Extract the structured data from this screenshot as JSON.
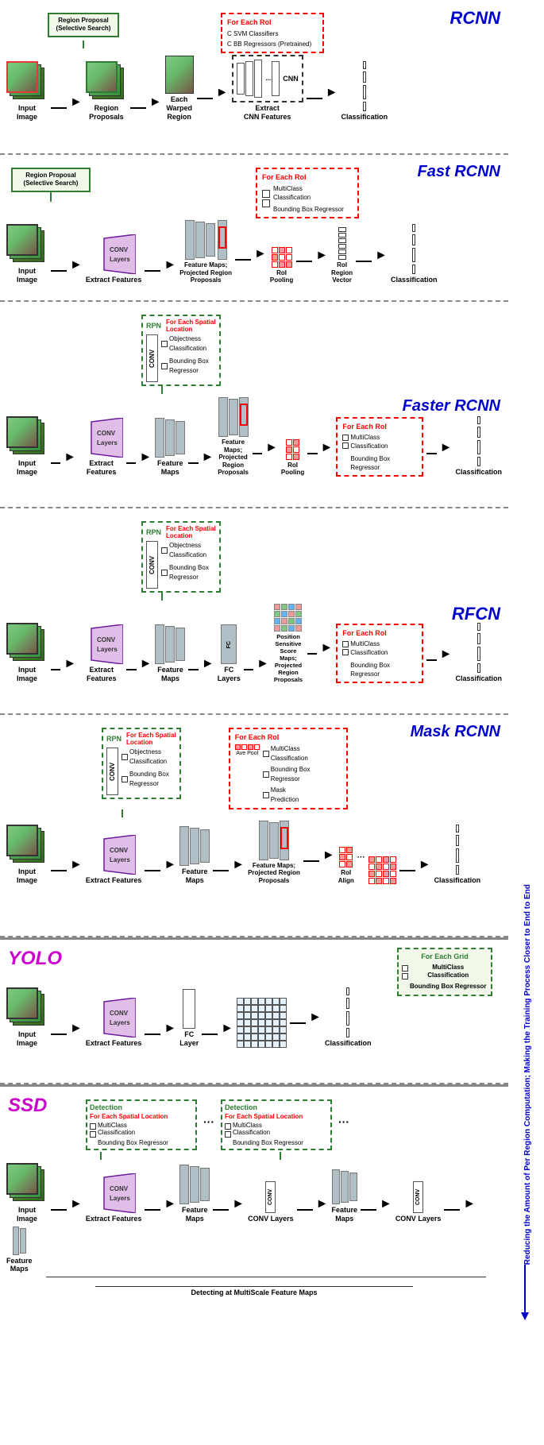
{
  "sections": [
    {
      "id": "rcnn",
      "title": "RCNN",
      "title_color": "#0000cc",
      "region_proposal_label": "Region Proposal\n(Selective Search)",
      "input_image_label": "Input\nImage",
      "region_proposals_label": "Region\nProposals",
      "each_warped_label": "Each\nWarped\nRegion",
      "extract_cnn_label": "Extract\nCNN Features",
      "classification_label": "Classification",
      "for_each_roi": "For Each RoI",
      "svm_label": "C SVM Classifiers",
      "bb_label": "C BB Regressors\n(Pretrained)"
    },
    {
      "id": "fastrcnn",
      "title": "Fast RCNN",
      "title_color": "#0000cc",
      "region_proposal_label": "Region Proposal\n(Selective Search)",
      "input_image_label": "Input\nImage",
      "extract_features_label": "Extract Features",
      "feature_maps_label": "Feature Maps;\nProjected Region\nProposals",
      "roi_region_vector_label": "RoI\nRegion\nVector",
      "classification_label": "Classification",
      "conv_layers_label": "CONV\nLayers",
      "roi_pooling_label": "RoI\nPooling",
      "for_each_roi": "For Each RoI",
      "multiclass_label": "MultiClass\nClassification",
      "bbox_label": "Bounding Box\nRegressor"
    },
    {
      "id": "fasterrcnn",
      "title": "Faster RCNN",
      "title_color": "#0000cc",
      "rpn_label": "RPN",
      "for_each_spatial": "For Each Spatial\nLocation",
      "objectness_label": "Objectness\nClassification",
      "bounding_box_rpn": "Bounding Box\nRegressor",
      "input_image_label": "Input\nImage",
      "extract_features_label": "Extract Features",
      "feature_maps_label": "Feature\nMaps",
      "feature_maps2_label": "Feature Maps;\nProjected Region\nProposals",
      "classification_label": "Classification",
      "conv_layers_label": "CONV\nLayers",
      "roi_pooling_label": "RoI\nPooling",
      "for_each_roi": "For Each RoI",
      "multiclass_label": "MultiClass\nClassification",
      "bbox_label": "Bounding Box\nRegressor"
    },
    {
      "id": "rfcn",
      "title": "RFCN",
      "title_color": "#0000cc",
      "rpn_label": "RPN",
      "for_each_spatial": "For Each Spatial\nLocation",
      "objectness_label": "Objectness\nClassification",
      "bounding_box_rpn": "Bounding Box\nRegressor",
      "input_image_label": "Input\nImage",
      "extract_features_label": "Extract Features",
      "feature_maps_label": "Feature\nMaps",
      "fc_layers_label": "FC\nLayers",
      "ps_maps_label": "Position Sensitive\nScore Maps;\nProjected Region\nProposals",
      "classification_label": "Classification",
      "conv_layers_label": "CONV\nLayers",
      "for_each_roi": "For Each RoI",
      "multiclass_label": "MultiClass\nClassification",
      "bbox_label": "Bounding Box\nRegressor"
    },
    {
      "id": "maskrcnn",
      "title": "Mask RCNN",
      "title_color": "#0000cc",
      "rpn_label": "RPN",
      "for_each_spatial": "For Each Spatial\nLocation",
      "objectness_label": "Objectness\nClassification",
      "bounding_box_rpn": "Bounding Box\nRegressor",
      "input_image_label": "Input\nImage",
      "extract_features_label": "Extract Features",
      "feature_maps_label": "Feature\nMaps",
      "feature_maps2_label": "Feature Maps;\nProjected Region\nProposals",
      "classification_label": "Classification",
      "conv_layers_label": "CONV\nLayers",
      "roi_align_label": "RoI\nAlign",
      "for_each_roi": "For Each RoI",
      "ave_pool_label": "Ave\nPool",
      "multiclass_label": "MultiClass\nClassification",
      "bbox_label": "Bounding Box\nRegressor",
      "mask_label": "Mask\nPrediction"
    },
    {
      "id": "yolo",
      "title": "YOLO",
      "title_color": "#cc00cc",
      "input_image_label": "Input\nImage",
      "extract_features_label": "Extract\nFeatures",
      "fc_layer_label": "FC\nLayer",
      "classification_label": "Classification",
      "conv_layers_label": "CONV\nLayers",
      "for_each_grid": "For Each Grid",
      "multiclass_label": "MultiClass\nClassification",
      "bbox_label": "Bounding Box\nRegressor"
    },
    {
      "id": "ssd",
      "title": "SSD",
      "title_color": "#cc00cc",
      "input_image_label": "Input\nImage",
      "extract_features_label": "Extract Features",
      "feature_maps_label": "Feature\nMaps",
      "conv_layers_label": "CONV\nLayers",
      "feature_maps2_label": "Feature\nMaps",
      "conv_layers2_label": "CONV\nLayers",
      "feature_maps3_label": "Feature\nMaps",
      "for_each_spatial1": "For Each Spatial\nLocation",
      "for_each_spatial2": "For Each Spatial\nLocation",
      "multiclass_label": "MultiClass\nClassification",
      "bbox_label": "Bounding Box\nRegressor",
      "detection1": "Detection",
      "detection2": "Detection",
      "multiscale_label": "Detecting at MultiScale Feature Maps"
    }
  ],
  "right_label": "Reducing the Amount of Per Region Computation; Making the Training Process Closer to End to End"
}
